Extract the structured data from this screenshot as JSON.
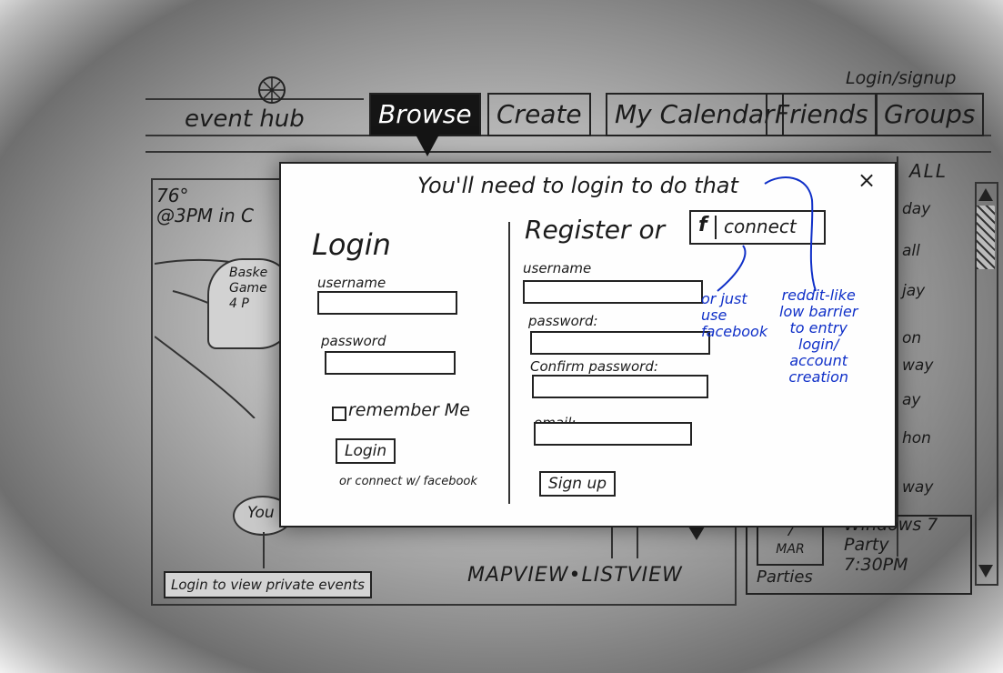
{
  "header": {
    "login_signup": "Login/signup",
    "app_name": "event hub",
    "tabs": [
      "Browse",
      "Create",
      "My Calendar",
      "Friends",
      "Groups"
    ]
  },
  "map": {
    "weather": [
      "76°",
      "@3PM in C"
    ],
    "bubble_text": [
      "Baske",
      "Game",
      "4 P"
    ],
    "you_label": "You",
    "private_prompt": "Login to view private events",
    "view_toggle": "MAPVIEW•LISTVIEW"
  },
  "sidebar": {
    "filter": "ALL",
    "items": [
      "day",
      "all",
      "jay",
      "on",
      "way",
      "ay",
      "hon",
      "way"
    ]
  },
  "event_card": {
    "day": "7",
    "month": "MAR",
    "title": "Windows 7",
    "subtitle": "Party",
    "time": "7:30PM",
    "category": "Parties"
  },
  "modal": {
    "title": "You'll need to login to do that",
    "close": "×",
    "login": {
      "heading": "Login",
      "username_label": "username",
      "password_label": "password",
      "remember": "remember Me",
      "button": "Login",
      "facebook_hint": "or connect w/ facebook"
    },
    "register": {
      "heading": "Register or",
      "fb_icon": "f",
      "fb_connect": "connect",
      "username_label": "username",
      "password_label": "password:",
      "confirm_label": "Confirm password:",
      "email_label": "email:",
      "button": "Sign up"
    },
    "notes": {
      "facebook": [
        "or just",
        "use",
        "facebook"
      ],
      "reddit": [
        "reddit-like",
        "low barrier",
        "to entry",
        "login/",
        "account",
        "creation"
      ]
    }
  },
  "colors": {
    "annotation": "#1030c8",
    "ink": "#1b1b1b"
  }
}
